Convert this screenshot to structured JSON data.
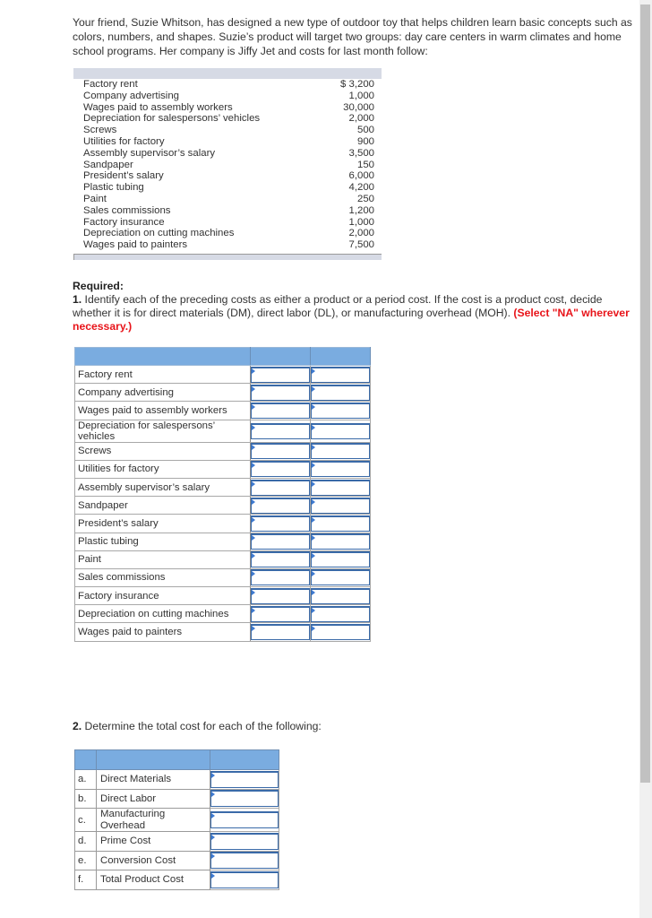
{
  "intro_text": "Your friend, Suzie Whitson, has designed a new type of outdoor toy that helps children learn basic concepts such as colors, numbers, and shapes. Suzie’s product will target two groups: day care centers in warm climates and home school programs. Her company is Jiffy Jet and costs for last month follow:",
  "cost_table": {
    "rows": [
      {
        "label": "Factory rent",
        "amount": "$  3,200"
      },
      {
        "label": "Company advertising",
        "amount": "1,000"
      },
      {
        "label": "Wages paid to assembly workers",
        "amount": "30,000"
      },
      {
        "label": "Depreciation for salespersons’ vehicles",
        "amount": "2,000"
      },
      {
        "label": "Screws",
        "amount": "500"
      },
      {
        "label": "Utilities for factory",
        "amount": "900"
      },
      {
        "label": "Assembly supervisor’s salary",
        "amount": "3,500"
      },
      {
        "label": "Sandpaper",
        "amount": "150"
      },
      {
        "label": "President’s salary",
        "amount": "6,000"
      },
      {
        "label": "Plastic tubing",
        "amount": "4,200"
      },
      {
        "label": "Paint",
        "amount": "250"
      },
      {
        "label": "Sales commissions",
        "amount": "1,200"
      },
      {
        "label": "Factory insurance",
        "amount": "1,000"
      },
      {
        "label": "Depreciation on cutting machines",
        "amount": "2,000"
      },
      {
        "label": "Wages paid to painters",
        "amount": "7,500"
      }
    ]
  },
  "required": {
    "heading": "Required:",
    "part1_number": "1.",
    "part1_text": " Identify each of the preceding costs as either a product or a period cost. If the cost is a product cost, decide whether it is for direct materials (DM), direct labor (DL), or manufacturing overhead (MOH). ",
    "part1_note": "(Select \"NA\" wherever necessary.)"
  },
  "classification_table": {
    "header": [
      "",
      "",
      ""
    ],
    "rows": [
      {
        "label": "Factory rent",
        "cost_type": "",
        "category": ""
      },
      {
        "label": "Company advertising",
        "cost_type": "",
        "category": ""
      },
      {
        "label": "Wages paid to assembly workers",
        "cost_type": "",
        "category": ""
      },
      {
        "label": "Depreciation for salespersons’ vehicles",
        "cost_type": "",
        "category": ""
      },
      {
        "label": "Screws",
        "cost_type": "",
        "category": ""
      },
      {
        "label": "Utilities for factory",
        "cost_type": "",
        "category": ""
      },
      {
        "label": "Assembly supervisor’s salary",
        "cost_type": "",
        "category": ""
      },
      {
        "label": "Sandpaper",
        "cost_type": "",
        "category": ""
      },
      {
        "label": "President’s salary",
        "cost_type": "",
        "category": ""
      },
      {
        "label": "Plastic tubing",
        "cost_type": "",
        "category": ""
      },
      {
        "label": "Paint",
        "cost_type": "",
        "category": ""
      },
      {
        "label": "Sales commissions",
        "cost_type": "",
        "category": ""
      },
      {
        "label": "Factory insurance",
        "cost_type": "",
        "category": ""
      },
      {
        "label": "Depreciation on cutting machines",
        "cost_type": "",
        "category": ""
      },
      {
        "label": "Wages paid to painters",
        "cost_type": "",
        "category": ""
      }
    ]
  },
  "part2": {
    "number": "2.",
    "text": " Determine the total cost for each of the following:",
    "rows": [
      {
        "letter": "a.",
        "label": "Direct Materials",
        "value": ""
      },
      {
        "letter": "b.",
        "label": "Direct Labor",
        "value": ""
      },
      {
        "letter": "c.",
        "label": "Manufacturing Overhead",
        "value": ""
      },
      {
        "letter": "d.",
        "label": "Prime Cost",
        "value": ""
      },
      {
        "letter": "e.",
        "label": "Conversion Cost",
        "value": ""
      },
      {
        "letter": "f.",
        "label": "Total Product Cost",
        "value": ""
      }
    ]
  },
  "colors": {
    "table_header_blue": "#7aace0",
    "cost_header_gray": "#d6dae5",
    "note_red": "#e8141a",
    "input_border_blue": "#3a6aa8"
  }
}
